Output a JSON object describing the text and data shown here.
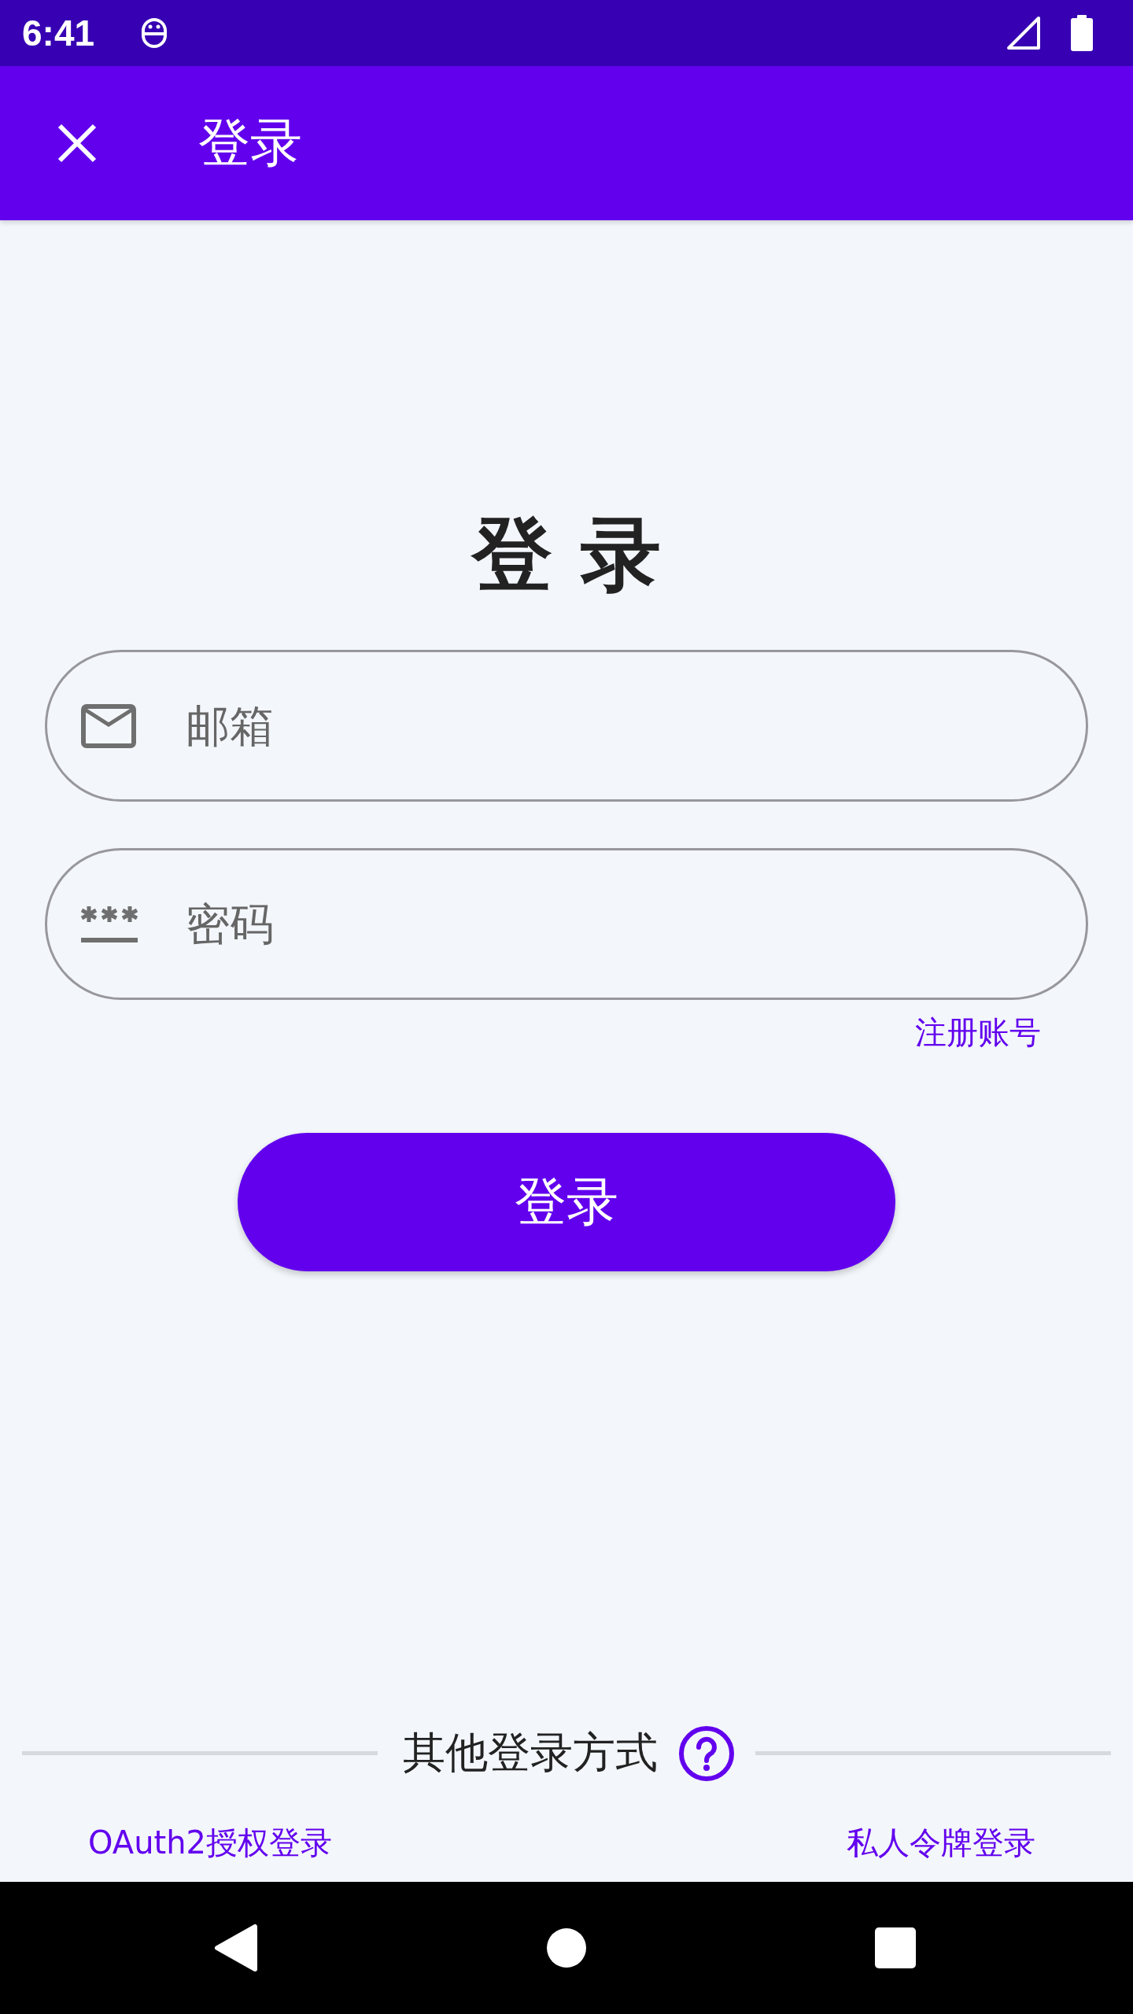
{
  "status_bar": {
    "time": "6:41"
  },
  "app_bar": {
    "title": "登录"
  },
  "heading": "登 录",
  "fields": [
    {
      "kind": "email",
      "placeholder": "邮箱"
    },
    {
      "kind": "password",
      "placeholder": "密码"
    }
  ],
  "register_link": "注册账号",
  "login_button": "登录",
  "other_methods": {
    "label": "其他登录方式",
    "links": [
      "OAuth2授权登录",
      "私人令牌登录"
    ]
  }
}
